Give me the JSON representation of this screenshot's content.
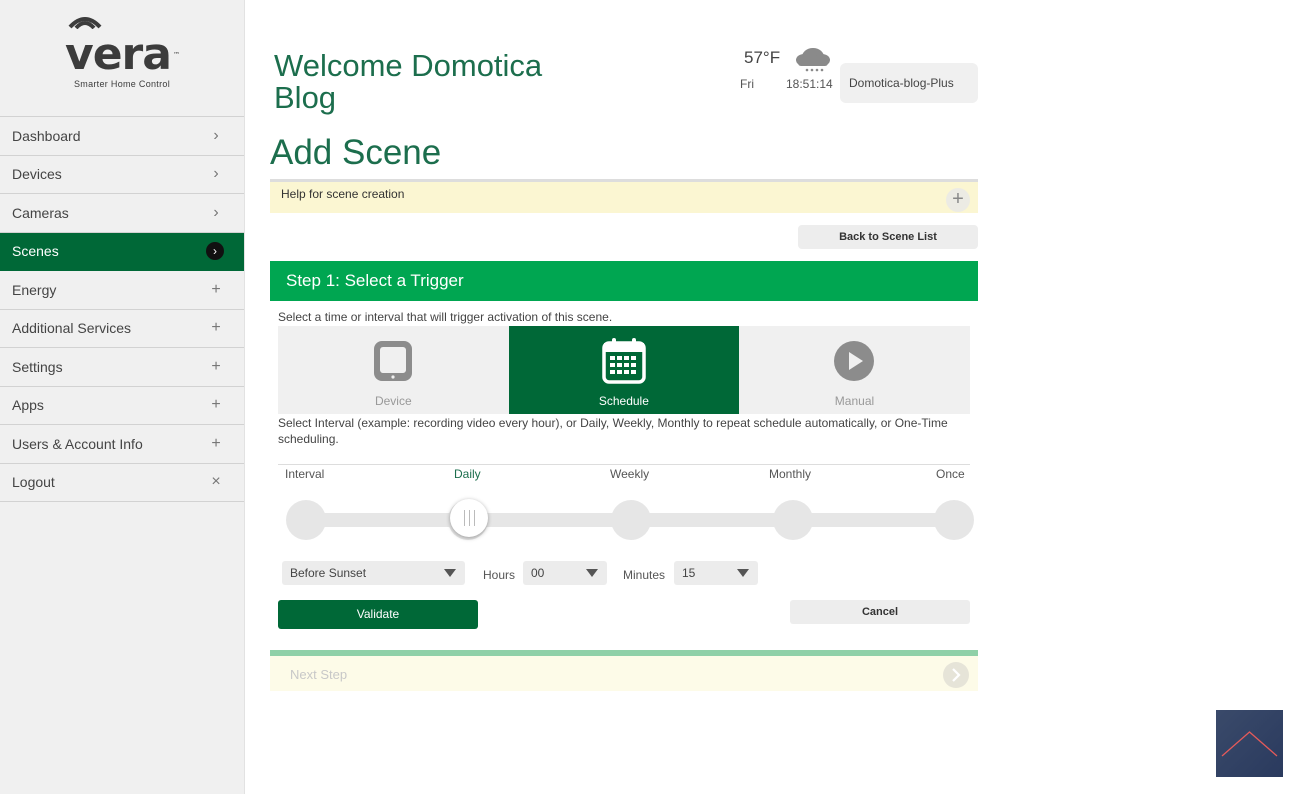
{
  "logo": {
    "word": "vera",
    "tm": "™",
    "tagline": "Smarter Home Control"
  },
  "sidebar": {
    "items": [
      {
        "label": "Dashboard",
        "icon": "chevron-right-icon",
        "glyph": "›"
      },
      {
        "label": "Devices",
        "icon": "chevron-right-icon",
        "glyph": "›"
      },
      {
        "label": "Cameras",
        "icon": "chevron-right-icon",
        "glyph": "›"
      },
      {
        "label": "Scenes",
        "icon": "chevron-right-icon",
        "glyph": "›",
        "active": true
      },
      {
        "label": "Energy",
        "icon": "plus-icon",
        "glyph": "+"
      },
      {
        "label": "Additional Services",
        "icon": "plus-icon",
        "glyph": "+"
      },
      {
        "label": "Settings",
        "icon": "plus-icon",
        "glyph": "+"
      },
      {
        "label": "Apps",
        "icon": "plus-icon",
        "glyph": "+"
      },
      {
        "label": "Users & Account Info",
        "icon": "plus-icon",
        "glyph": "+"
      },
      {
        "label": "Logout",
        "icon": "close-icon",
        "glyph": "×"
      }
    ]
  },
  "header": {
    "welcome": "Welcome Domotica Blog",
    "weather": {
      "temp": "57°F",
      "day": "Fri",
      "time": "18:51:14",
      "icon": "cloud-snow-icon"
    },
    "account": "Domotica-blog-Plus"
  },
  "page": {
    "title": "Add Scene",
    "help": "Help for scene creation",
    "back_button": "Back to Scene List"
  },
  "step": {
    "title": "Step 1: Select a Trigger",
    "description": "Select a time or interval that will trigger activation of this scene.",
    "triggers": [
      {
        "label": "Device",
        "icon": "tablet-icon"
      },
      {
        "label": "Schedule",
        "icon": "calendar-icon",
        "active": true
      },
      {
        "label": "Manual",
        "icon": "play-icon"
      }
    ],
    "schedule_description": "Select Interval (example: recording video every hour), or Daily, Weekly, Monthly to repeat schedule automatically, or One-Time scheduling.",
    "intervals": [
      "Interval",
      "Daily",
      "Weekly",
      "Monthly",
      "Once"
    ],
    "selected_interval": "Daily",
    "time_mode": "Before Sunset",
    "hours_label": "Hours",
    "hours": "00",
    "minutes_label": "Minutes",
    "minutes": "15",
    "validate": "Validate",
    "cancel": "Cancel",
    "next": "Next Step"
  },
  "colors": {
    "brand_dark": "#006837",
    "step_green": "#00a651",
    "title_green": "#1c6e4d",
    "help_bg": "#fbf6d2"
  }
}
